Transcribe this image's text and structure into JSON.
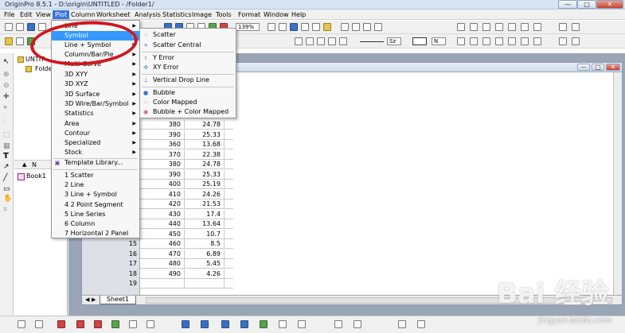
{
  "titlebar": {
    "title": "OriginPro 8.5.1 - D:\\origin\\UNTITLED - /Folder1/",
    "min": "—",
    "max": "□",
    "close": "✕"
  },
  "menubar": [
    "File",
    "Edit",
    "View",
    "Plot",
    "Column",
    "Worksheet",
    "Analysis",
    "Statistics",
    "Image",
    "Tools",
    "Format",
    "Window",
    "Help"
  ],
  "toolbar": {
    "zoom": "139%",
    "font_size": "Sz",
    "line_width": "N"
  },
  "explorer": {
    "root": "UNTIT",
    "folder": "Folde",
    "col_name": "N",
    "book": "Book1"
  },
  "plot_menu": {
    "items": [
      {
        "label": "Line",
        "arrow": "▶"
      },
      {
        "label": "Symbol",
        "arrow": "▶"
      },
      {
        "label": "Line + Symbol",
        "arrow": "▶"
      },
      {
        "label": "Column/Bar/Pie",
        "arrow": "▶"
      },
      {
        "label": "Multi-Curve",
        "arrow": "▶"
      },
      {
        "label": "3D XYY",
        "arrow": "▶"
      },
      {
        "label": "3D XYZ",
        "arrow": "▶"
      },
      {
        "label": "3D Surface",
        "arrow": "▶"
      },
      {
        "label": "3D Wire/Bar/Symbol",
        "arrow": "▶"
      },
      {
        "label": "Statistics",
        "arrow": "▶"
      },
      {
        "label": "Area",
        "arrow": "▶"
      },
      {
        "label": "Contour",
        "arrow": "▶"
      },
      {
        "label": "Specialized",
        "arrow": "▶"
      },
      {
        "label": "Stock",
        "arrow": "▶"
      },
      {
        "label": "Template Library...",
        "arrow": ""
      },
      {
        "label": "1 Scatter",
        "arrow": ""
      },
      {
        "label": "2 Line",
        "arrow": ""
      },
      {
        "label": "3 Line + Symbol",
        "arrow": ""
      },
      {
        "label": "4 2 Point Segment",
        "arrow": ""
      },
      {
        "label": "5 Line Series",
        "arrow": ""
      },
      {
        "label": "6 Column",
        "arrow": ""
      },
      {
        "label": "7 Horizontal 2 Panel",
        "arrow": ""
      }
    ]
  },
  "symbol_submenu": {
    "items": [
      {
        "label": "Scatter",
        "icon": "·:"
      },
      {
        "label": "Scatter Central",
        "icon": "+"
      },
      {
        "label": "Y Error",
        "icon": "I"
      },
      {
        "label": "XY Error",
        "icon": "✣"
      },
      {
        "label": "Vertical Drop Line",
        "icon": "⊥"
      },
      {
        "label": "Bubble",
        "icon": "●"
      },
      {
        "label": "Color Mapped",
        "icon": "⁘"
      },
      {
        "label": "Bubble + Color Mapped",
        "icon": "◉"
      }
    ]
  },
  "worksheet": {
    "rows": [
      {
        "n": "",
        "a": "380",
        "b": "24.78"
      },
      {
        "n": "",
        "a": "390",
        "b": "25.33"
      },
      {
        "n": "",
        "a": "360",
        "b": "13.68"
      },
      {
        "n": "",
        "a": "370",
        "b": "22.38"
      },
      {
        "n": "",
        "a": "380",
        "b": "24.78"
      },
      {
        "n": "",
        "a": "390",
        "b": "25.33"
      },
      {
        "n": "",
        "a": "400",
        "b": "25.19"
      },
      {
        "n": "",
        "a": "410",
        "b": "24.26"
      },
      {
        "n": "",
        "a": "420",
        "b": "21.53"
      },
      {
        "n": "",
        "a": "430",
        "b": "17.4"
      },
      {
        "n": "",
        "a": "440",
        "b": "13.64"
      },
      {
        "n": "",
        "a": "450",
        "b": "10.7"
      },
      {
        "n": "15",
        "a": "460",
        "b": "8.5"
      },
      {
        "n": "16",
        "a": "470",
        "b": "6.89"
      },
      {
        "n": "17",
        "a": "480",
        "b": "5.45"
      },
      {
        "n": "18",
        "a": "490",
        "b": "4.26"
      },
      {
        "n": "19",
        "a": "",
        "b": ""
      }
    ],
    "sheet_tab": "Sheet1"
  },
  "watermark": {
    "text": "Bai 经验",
    "url": "jingyan.baidu.com"
  },
  "colors": {
    "highlight": "#3399ff",
    "annotation": "#d0161f"
  }
}
